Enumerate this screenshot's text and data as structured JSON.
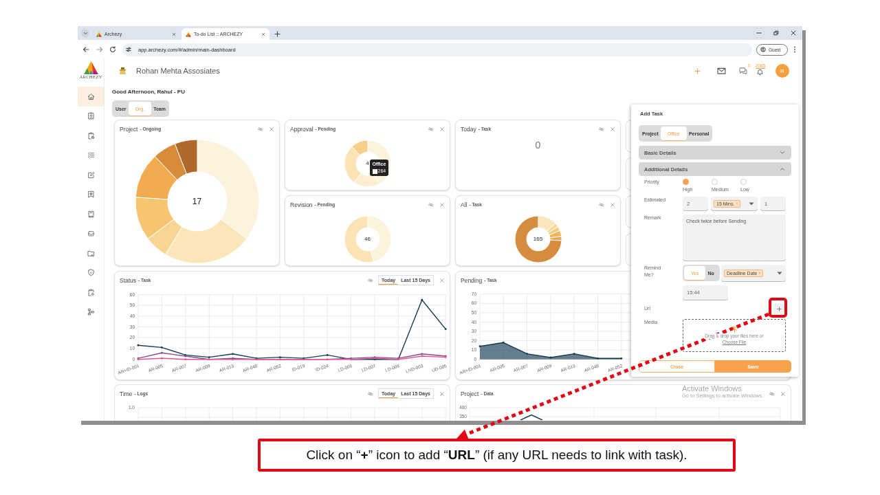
{
  "browser": {
    "tabs": [
      {
        "label": "Archezy",
        "selected": false
      },
      {
        "label": "To-do List :: ARCHEZY",
        "selected": true
      }
    ],
    "address": "app.archezy.com/#/admin/main-dashboard",
    "profile": "Guest"
  },
  "sidebar": {
    "logo_text": "ARCHEZY",
    "items": [
      {
        "selected": true
      },
      {
        "selected": false
      },
      {
        "selected": false
      },
      {
        "selected": false
      },
      {
        "selected": false
      },
      {
        "selected": false
      },
      {
        "selected": false
      },
      {
        "selected": false
      },
      {
        "selected": false
      },
      {
        "selected": false
      },
      {
        "selected": false
      },
      {
        "selected": false
      }
    ]
  },
  "header": {
    "company": "Rohan Mehta Assosiates",
    "chat_count": "0",
    "notification_count": "2065",
    "avatar_initial": "R"
  },
  "greeting": "Good Afternoon, Rahul - PU",
  "scope": [
    {
      "label": "User",
      "selected": false
    },
    {
      "label": "Org.",
      "selected": true
    },
    {
      "label": "Team",
      "selected": false
    }
  ],
  "summary_cards": [
    {
      "kind": "donut",
      "title": "Project",
      "subtitle": "- Ongoing",
      "total": "17"
    },
    {
      "kind": "donut",
      "title": "Approval",
      "subtitle": "- Pending",
      "total": "4",
      "tooltip": {
        "label": "Office",
        "value": "264"
      }
    },
    {
      "kind": "count",
      "title": "Today",
      "subtitle": "- Task",
      "total": "0"
    },
    {
      "kind": "donut",
      "title": "Revision",
      "subtitle": "- Pending",
      "total": "46"
    },
    {
      "kind": "donut",
      "title": "All",
      "subtitle": "- Task",
      "total": "165"
    }
  ],
  "status_card": {
    "title": "Status",
    "subtitle": "- Task",
    "range": [
      {
        "label": "Today",
        "selected": true
      },
      {
        "label": "Last 15 Days",
        "selected": false
      }
    ],
    "chart_data": {
      "type": "line",
      "categories": [
        "AR+ID-001",
        "AR-005",
        "AR-007",
        "AR-009",
        "AR-013",
        "AR-048",
        "AR-052",
        "ID-019",
        "ID-024",
        "LD-006",
        "LD-007",
        "LD-008",
        "LND-003",
        "UD-005"
      ],
      "series": [
        {
          "color": "#123a52",
          "values": [
            13,
            11,
            4,
            2,
            5,
            1,
            2,
            1,
            4,
            0,
            0,
            0,
            55,
            28
          ]
        },
        {
          "color": "#7d4c97",
          "values": [
            1,
            6,
            3,
            0,
            1,
            0,
            0,
            0,
            0,
            1,
            2,
            1,
            5,
            3
          ]
        },
        {
          "color": "#e8508a",
          "values": [
            0,
            1,
            0,
            0,
            0,
            0,
            0,
            0,
            0,
            0,
            1,
            0,
            3,
            2
          ]
        }
      ],
      "ylim": [
        0,
        60
      ],
      "yticks": [
        0,
        10,
        20,
        30,
        40,
        50,
        60
      ],
      "grid": true
    }
  },
  "pending_card": {
    "title": "Pending",
    "subtitle": "- Task",
    "chart_data": {
      "type": "area",
      "categories": [
        "AR+ID-001",
        "AR-005",
        "AR-007",
        "AR-009",
        "AR-013",
        "AR-048",
        "AR-052"
      ],
      "series": [
        {
          "color": "#123a52",
          "values": [
            14,
            18,
            6,
            2,
            6,
            1,
            1
          ]
        }
      ],
      "ylim": [
        0,
        70
      ],
      "yticks": [
        0,
        10,
        20,
        30,
        40,
        50,
        60,
        70
      ],
      "grid": true
    }
  },
  "time_card": {
    "title": "Time",
    "subtitle": "- Logs",
    "range": [
      {
        "label": "Today",
        "selected": true
      },
      {
        "label": "Last 15 Days",
        "selected": false
      }
    ],
    "ytick_labels": [
      "1.0"
    ]
  },
  "project_data_card": {
    "title": "Project",
    "subtitle": "- Data",
    "ytick_labels": [
      "400",
      "350"
    ]
  },
  "add_task": {
    "title": "Add Task",
    "types": [
      {
        "label": "Project",
        "selected": false
      },
      {
        "label": "Office",
        "selected": true
      },
      {
        "label": "Personal",
        "selected": false
      }
    ],
    "sections": [
      {
        "label": "Basic Details",
        "expanded": false
      },
      {
        "label": "Additional Details",
        "expanded": true
      }
    ],
    "priority": {
      "label": "Priority",
      "options": [
        {
          "label": "High",
          "selected": true
        },
        {
          "label": "Medium",
          "selected": false
        },
        {
          "label": "Low",
          "selected": false
        }
      ]
    },
    "estimated": {
      "label": "Estimated",
      "value": "2",
      "unit": "15 Mins.",
      "count": "1"
    },
    "remark": {
      "label": "Remark",
      "value": "Check twice before Sending"
    },
    "remind": {
      "label": "Remind Me?",
      "options": [
        {
          "label": "Yes",
          "selected": true
        },
        {
          "label": "No",
          "selected": false
        }
      ],
      "trigger": "Deadline Date",
      "time": "15:44"
    },
    "url": {
      "label": "Url"
    },
    "media": {
      "label": "Media",
      "hint": "Drag & drop your files here or",
      "link": "Choose File"
    },
    "buttons": [
      {
        "label": "Close",
        "kind": "secondary"
      },
      {
        "label": "Save",
        "kind": "primary"
      }
    ]
  },
  "system_notice": {
    "title": "Activate Windows",
    "text": "Go to Settings to activate Windows."
  },
  "callout": "Click on “**+**” icon to add “**URL**” (if any URL needs to link with task)."
}
